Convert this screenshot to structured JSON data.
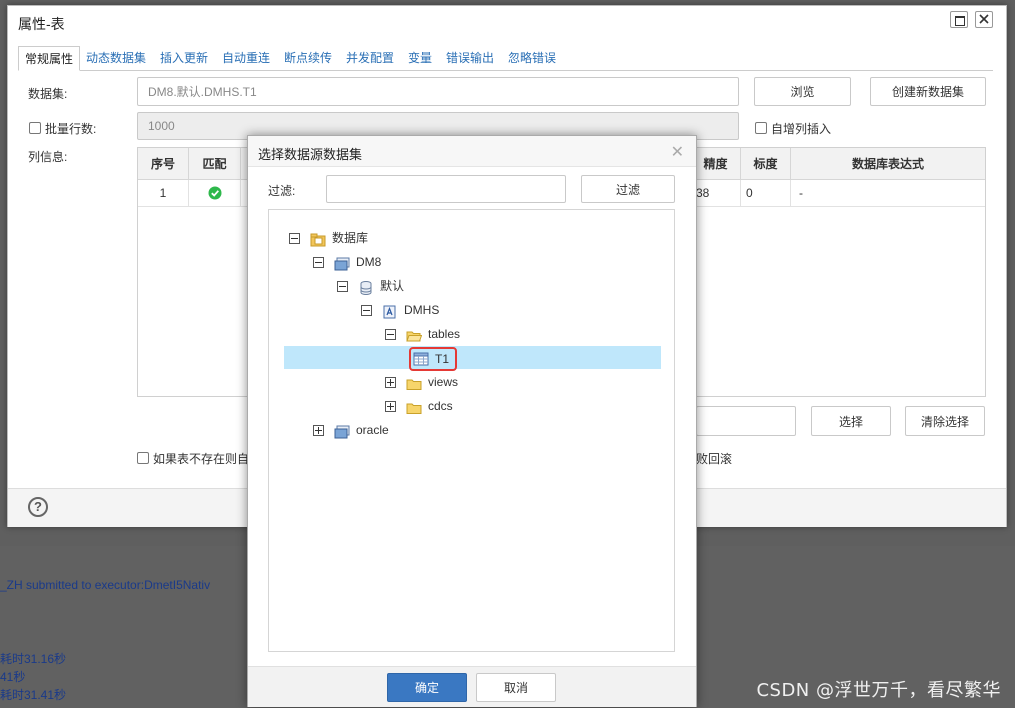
{
  "outer_dialog": {
    "title": "属性-表",
    "tabs": [
      "常规属性",
      "动态数据集",
      "插入更新",
      "自动重连",
      "断点续传",
      "并发配置",
      "变量",
      "错误输出",
      "忽略错误"
    ],
    "dataset_label": "数据集:",
    "dataset_value": "DM8.默认.DMHS.T1",
    "browse_button": "浏览",
    "create_dataset_button": "创建新数据集",
    "batch_rows_label": "批量行数:",
    "batch_rows_value": "1000",
    "auto_increment_label": "自增列插入",
    "column_info_label": "列信息:",
    "table_headers": {
      "seq": "序号",
      "match": "匹配",
      "precision": "精度",
      "scale": "标度",
      "expr": "数据库表达式"
    },
    "table_row": {
      "seq": "1",
      "precision": "38",
      "scale": "0",
      "expr": "-"
    },
    "select_button": "选择",
    "clear_select_button": "清除选择",
    "create_if_missing_label": "如果表不存在则自",
    "rollback_label": "失败回滚"
  },
  "modal": {
    "title": "选择数据源数据集",
    "filter_label": "过滤:",
    "filter_value": "",
    "filter_button": "过滤",
    "tree": {
      "root": "数据库",
      "dm8": "DM8",
      "default": "默认",
      "dmhs": "DMHS",
      "tables": "tables",
      "t1": "T1",
      "views": "views",
      "cdcs": "cdcs",
      "oracle": "oracle"
    },
    "ok_button": "确定",
    "cancel_button": "取消"
  },
  "background_log": {
    "line1": "_ZH submitted to executor:DmetI5Nativ",
    "line2": "耗时31.16秒",
    "line3": "41秒",
    "line4": "耗时31.41秒"
  },
  "watermark": "CSDN @浮世万千，看尽繁华",
  "colors": {
    "accent_blue": "#3a78c2",
    "selection": "#bfe7fb",
    "highlight_red": "#e53935",
    "check_green": "#2eb84b"
  }
}
